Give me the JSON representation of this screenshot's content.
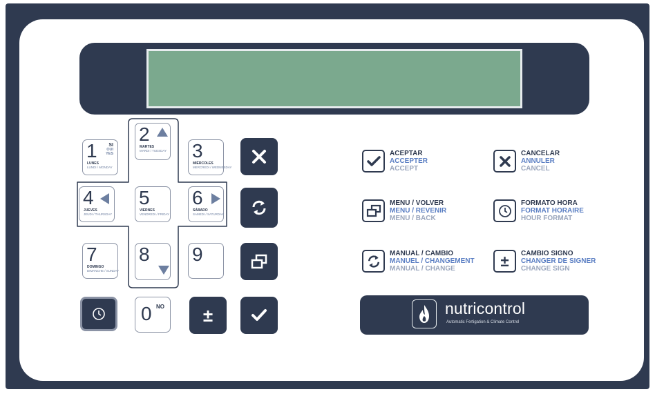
{
  "keypad": {
    "k1": {
      "digit": "1",
      "day": "LUNES",
      "day_alt": "LUNDI / MONDAY",
      "yes": [
        "SI",
        "OUI",
        "YES"
      ]
    },
    "k2": {
      "digit": "2",
      "day": "MARTES",
      "day_alt": "MARDI / TUESDAY"
    },
    "k3": {
      "digit": "3",
      "day": "MIÉRCOLES",
      "day_alt": "MERCREDI / WEDNESDAY"
    },
    "k4": {
      "digit": "4",
      "day": "JUEVES",
      "day_alt": "JEUDI / THURSDAY"
    },
    "k5": {
      "digit": "5",
      "day": "VIERNES",
      "day_alt": "VENDREDI / FRIDAY"
    },
    "k6": {
      "digit": "6",
      "day": "SÁBADO",
      "day_alt": "SAMEDI / SATURDAY"
    },
    "k7": {
      "digit": "7",
      "day": "DOMINGO",
      "day_alt": "DIMANCHE / SUNDAY"
    },
    "k8": {
      "digit": "8"
    },
    "k9": {
      "digit": "9"
    },
    "k0": {
      "digit": "0",
      "no": "NO"
    },
    "plus_minus": "±"
  },
  "legend": {
    "accept": [
      "ACEPTAR",
      "ACCEPTER",
      "ACCEPT"
    ],
    "cancel": [
      "CANCELAR",
      "ANNULER",
      "CANCEL"
    ],
    "menu": [
      "MENU / VOLVER",
      "MENU / REVENIR",
      "MENU / BACK"
    ],
    "time_format": [
      "FORMATO HORA",
      "FORMAT HORAIRE",
      "HOUR FORMAT"
    ],
    "manual": [
      "MANUAL / CAMBIO",
      "MANUEL / CHANGEMENT",
      "MANUAL / CHANGE"
    ],
    "sign": [
      "CAMBIO SIGNO",
      "CHANGER DE SIGNER",
      "CHANGE SIGN"
    ],
    "plus_minus": "±"
  },
  "brand": {
    "name": "nutricontrol",
    "tagline": "Automatic Fertigation & Climate Control"
  },
  "colors": {
    "panel_dark": "#2f3a50",
    "lcd": "#7ba98e",
    "accent_blue": "#5a7ec3",
    "muted_blue": "#9aa6bd"
  }
}
